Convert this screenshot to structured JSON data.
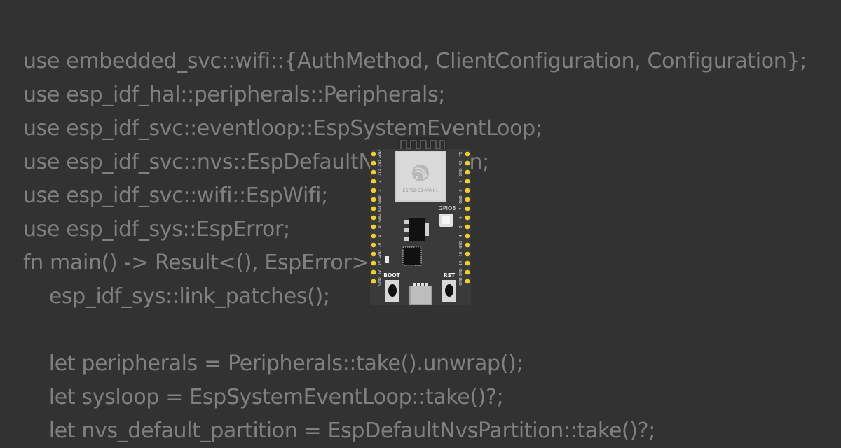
{
  "code_lines": [
    "use embedded_svc::wifi::{AuthMethod, ClientConfiguration, Configuration};",
    "use esp_idf_hal::peripherals::Peripherals;",
    "use esp_idf_svc::eventloop::EspSystemEventLoop;",
    "use esp_idf_svc::nvs::EspDefaultNvsPartition;",
    "use esp_idf_svc::wifi::EspWifi;",
    "use esp_idf_sys::EspError;",
    "fn main() -> Result<(), EspError> {",
    "    esp_idf_sys::link_patches();",
    "",
    "    let peripherals = Peripherals::take().unwrap();",
    "    let sysloop = EspSystemEventLoop::take()?;",
    "    let nvs_default_partition = EspDefaultNvsPartition::take()?;"
  ],
  "board": {
    "module_label": "ESP32-C3-MINI-1",
    "led_label": "GPIO8",
    "boot_label": "BOOT",
    "rst_label": "RST",
    "left_pins": [
      "GND",
      "3V3",
      "3V3",
      "2",
      "3",
      "GND",
      "RST",
      "GND",
      "0",
      "1",
      "10",
      "GND",
      "5V",
      "5V",
      "GND"
    ],
    "right_pins": [
      "TX",
      "RX",
      "GND",
      "9",
      "8",
      "GND",
      "7",
      "6",
      "5",
      "4",
      "GND",
      "18",
      "19",
      "GND",
      "GND"
    ],
    "colors": {
      "pcb": "#3a3a3a",
      "pin": "#f2d020",
      "module_shield": "#d6d6d6",
      "antenna": "#2c2c2c"
    }
  }
}
